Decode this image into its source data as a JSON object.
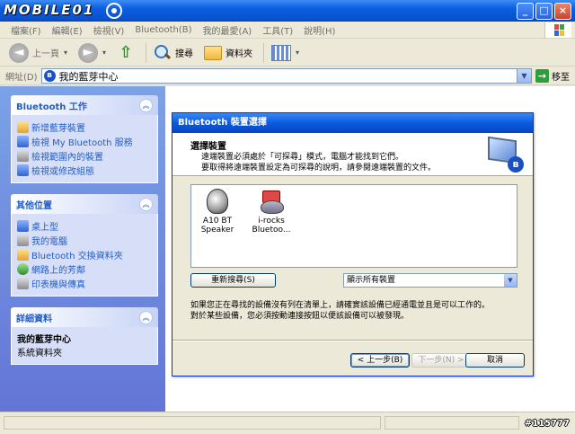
{
  "window": {
    "logo_text": "MOBILE01",
    "btn_minimize": "_",
    "btn_maximize": "□",
    "btn_close": "×"
  },
  "menu": {
    "items": [
      "檔案(F)",
      "編輯(E)",
      "檢視(V)",
      "Bluetooth(B)",
      "我的最愛(A)",
      "工具(T)",
      "說明(H)"
    ]
  },
  "toolbar": {
    "back_glyph": "◄",
    "back_label": "上一頁",
    "forward_glyph": "►",
    "up_glyph": "⇧",
    "search_label": "搜尋",
    "folders_label": "資料夾",
    "dropdown_glyph": "▾"
  },
  "address": {
    "label": "網址(D)",
    "value": "我的藍芽中心",
    "bt_glyph": "ʙ",
    "drop_glyph": "▼",
    "go_glyph": "→",
    "go_label": "移至"
  },
  "taskpane": {
    "collapse_glyph": "︽",
    "bluetooth_tasks": {
      "title": "Bluetooth 工作",
      "items": [
        "新增藍芽裝置",
        "檢視 My Bluetooth 服務",
        "檢視範圍內的裝置",
        "檢視或修改組態"
      ]
    },
    "other_places": {
      "title": "其他位置",
      "items": [
        "桌上型",
        "我的電腦",
        "Bluetooth 交換資料夾",
        "網路上的芳鄰",
        "印表機與傳真"
      ]
    },
    "details": {
      "title": "詳細資料",
      "name": "我的藍芽中心",
      "type": "系統資料夾"
    }
  },
  "dialog": {
    "title": "Bluetooth 裝置選擇",
    "heading": "選擇裝置",
    "line1": "遠端裝置必須處於「可探尋」模式，電腦才能找到它們。",
    "line2": "要取得將遠端裝置設定為可探尋的說明，請參閱遠端裝置的文件。",
    "bt_badge": "ʙ",
    "devices": [
      {
        "line1": "A10 BT",
        "line2": "Speaker"
      },
      {
        "line1": "i-rocks",
        "line2": "Bluetoo..."
      }
    ],
    "rescan_label": "重新搜尋(S)",
    "filter_value": "顯示所有裝置",
    "filter_drop": "▼",
    "hint1": "如果您正在尋找的設備沒有列在清單上，請確實該設備已經通電並且是可以工作的。",
    "hint2": "對於某些設備，您必須按動連接按鈕以便該設備可以被發現。",
    "back_label": "< 上一步(B)",
    "next_label": "下一步(N) >",
    "cancel_label": "取消"
  },
  "watermark": "#115777"
}
